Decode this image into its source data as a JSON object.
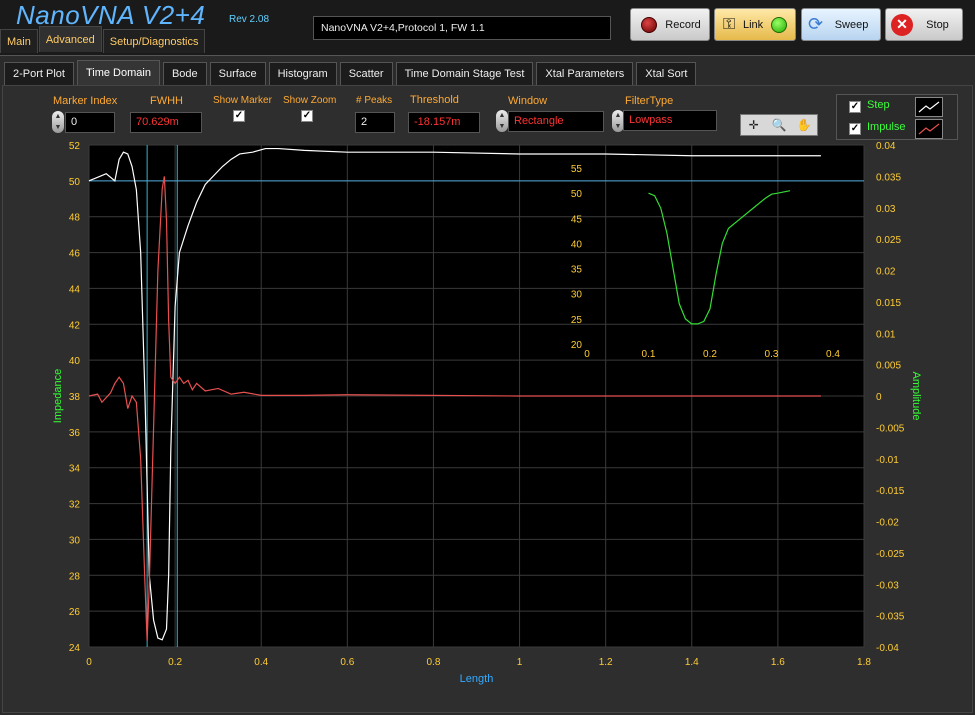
{
  "app": {
    "title": "NanoVNA V2+4",
    "rev": "Rev 2.08",
    "status": "NanoVNA V2+4,Protocol 1, FW 1.1"
  },
  "main_tabs": [
    {
      "label": "Main"
    },
    {
      "label": "Advanced"
    },
    {
      "label": "Setup/Diagnostics"
    }
  ],
  "toolbar": {
    "record": "Record",
    "link": "Link",
    "sweep": "Sweep",
    "stop": "Stop"
  },
  "sub_tabs": [
    {
      "label": "2-Port Plot"
    },
    {
      "label": "Time Domain"
    },
    {
      "label": "Bode"
    },
    {
      "label": "Surface"
    },
    {
      "label": "Histogram"
    },
    {
      "label": "Scatter"
    },
    {
      "label": "Time Domain Stage Test"
    },
    {
      "label": "Xtal Parameters"
    },
    {
      "label": "Xtal Sort"
    }
  ],
  "controls": {
    "marker_index": {
      "label": "Marker Index",
      "value": "0"
    },
    "fwhh": {
      "label": "FWHH",
      "value": "70.629m"
    },
    "show_marker": {
      "label": "Show Marker",
      "checked": true
    },
    "show_zoom": {
      "label": "Show Zoom",
      "checked": true
    },
    "peaks": {
      "label": "# Peaks",
      "value": "2"
    },
    "threshold": {
      "label": "Threshold",
      "value": "-18.157m"
    },
    "window": {
      "label": "Window",
      "value": "Rectangle"
    },
    "filter": {
      "label": "FilterType",
      "value": "Lowpass"
    }
  },
  "legend": {
    "step": "Step",
    "impulse": "Impulse"
  },
  "chart_data": {
    "type": "line",
    "xlabel": "Length",
    "ylabel": "Impedance",
    "y2label": "Amplitude",
    "xlim": [
      0,
      1.8
    ],
    "ylim": [
      24,
      52
    ],
    "y2lim": [
      -0.04,
      0.04
    ],
    "x_ticks": [
      "0",
      "0.2",
      "0.4",
      "0.6",
      "0.8",
      "1",
      "1.2",
      "1.4",
      "1.6",
      "1.8"
    ],
    "y_ticks": [
      "52",
      "50",
      "48",
      "46",
      "44",
      "42",
      "40",
      "38",
      "36",
      "34",
      "32",
      "30",
      "28",
      "26",
      "24"
    ],
    "y2_ticks": [
      "0.04",
      "0.035",
      "0.03",
      "0.025",
      "0.02",
      "0.015",
      "0.01",
      "0.005",
      "0",
      "-0.005",
      "-0.01",
      "-0.015",
      "-0.02",
      "-0.025",
      "-0.03",
      "-0.035",
      "-0.04"
    ],
    "markers_x": [
      0.135,
      0.205
    ],
    "ref_line_y": 50,
    "series": [
      {
        "name": "Step",
        "color": "#ffffff",
        "axis": "left",
        "x": [
          0,
          0.02,
          0.04,
          0.06,
          0.07,
          0.08,
          0.09,
          0.1,
          0.11,
          0.12,
          0.13,
          0.135,
          0.14,
          0.15,
          0.16,
          0.17,
          0.18,
          0.185,
          0.19,
          0.2,
          0.21,
          0.23,
          0.25,
          0.27,
          0.29,
          0.31,
          0.33,
          0.35,
          0.38,
          0.41,
          0.44,
          0.5,
          0.6,
          0.8,
          1.0,
          1.2,
          1.4,
          1.6,
          1.7
        ],
        "y": [
          50,
          50.2,
          50.4,
          50,
          51.2,
          51.6,
          51.5,
          50.8,
          49.5,
          46,
          38,
          33,
          28,
          25.5,
          24.5,
          24.4,
          25,
          28,
          35,
          43,
          46,
          47.5,
          48.8,
          49.8,
          50.3,
          50.8,
          51.2,
          51.5,
          51.6,
          51.8,
          51.8,
          51.7,
          51.6,
          51.6,
          51.5,
          51.5,
          51.4,
          51.4,
          51.4
        ]
      },
      {
        "name": "Impulse",
        "color": "#e85050",
        "axis": "right",
        "x": [
          0,
          0.02,
          0.03,
          0.05,
          0.06,
          0.07,
          0.08,
          0.09,
          0.1,
          0.11,
          0.12,
          0.13,
          0.135,
          0.14,
          0.15,
          0.16,
          0.17,
          0.175,
          0.18,
          0.185,
          0.19,
          0.2,
          0.21,
          0.22,
          0.23,
          0.24,
          0.25,
          0.27,
          0.3,
          0.33,
          0.36,
          0.4,
          0.5,
          0.6,
          1.0,
          1.4,
          1.7
        ],
        "y": [
          0,
          0.0003,
          -0.001,
          0.0005,
          0.002,
          0.003,
          0.002,
          -0.002,
          0,
          -0.001,
          -0.01,
          -0.03,
          -0.039,
          -0.03,
          -0.005,
          0.02,
          0.033,
          0.035,
          0.028,
          0.012,
          0.003,
          0.002,
          0.003,
          0.002,
          0.0025,
          0.001,
          0.002,
          0.0008,
          0.0012,
          0.0003,
          0.0006,
          0.0001,
          0.0001,
          0.0002,
          0,
          0,
          0
        ]
      }
    ],
    "inset": {
      "x_ticks": [
        "0",
        "0.1",
        "0.2",
        "0.3",
        "0.4"
      ],
      "y_ticks": [
        "55",
        "50",
        "45",
        "40",
        "35",
        "30",
        "25",
        "20"
      ],
      "xlim": [
        0,
        0.4
      ],
      "ylim": [
        20,
        57
      ],
      "series": {
        "name": "",
        "color": "#33dd33",
        "x": [
          0.1,
          0.11,
          0.12,
          0.13,
          0.14,
          0.15,
          0.16,
          0.17,
          0.18,
          0.19,
          0.2,
          0.21,
          0.22,
          0.23,
          0.25,
          0.27,
          0.29,
          0.3,
          0.31,
          0.33
        ],
        "y": [
          50,
          49.5,
          47,
          42,
          35,
          28,
          25,
          24,
          24,
          24.5,
          27,
          34,
          40,
          43,
          45,
          47,
          49,
          49.8,
          50,
          50.5
        ]
      }
    }
  }
}
